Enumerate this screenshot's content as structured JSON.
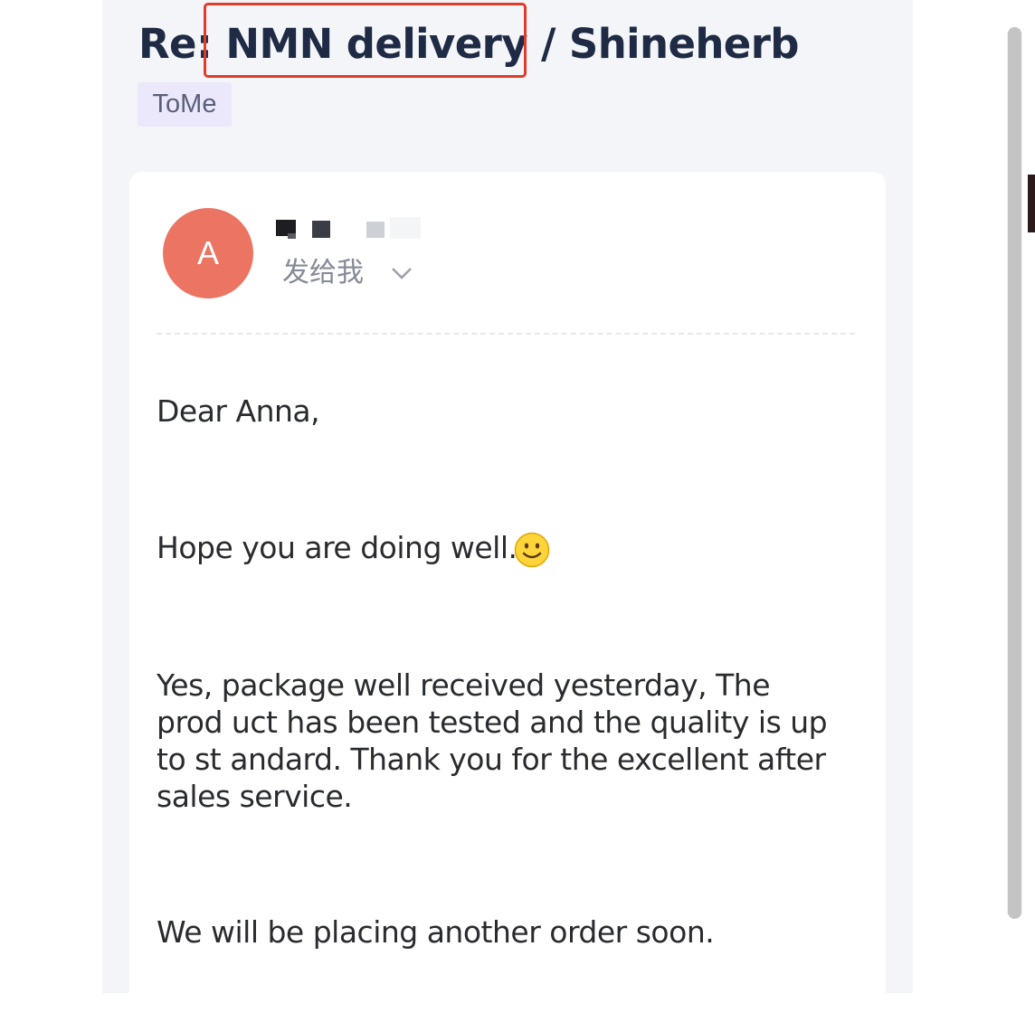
{
  "email": {
    "subject": "Re: NMN delivery / Shineherb",
    "tag": "ToMe",
    "avatar_initial": "A",
    "recipient_line": "发给我",
    "body": [
      "Dear Anna,",
      "Hope you are doing well.",
      "Yes, package well received yesterday, The prod uct has been tested and the quality is up to st andard. Thank you for the excellent after sales service.",
      "We will be placing another order soon."
    ]
  },
  "icons": {
    "recipient_toggle": "chevron-down-icon",
    "smile": "smiling-face-icon"
  },
  "colors": {
    "avatar": "#ec7463",
    "highlight_border": "#e23b2a",
    "tag_background": "#ece8fb",
    "subject_text": "#1f2a44"
  }
}
